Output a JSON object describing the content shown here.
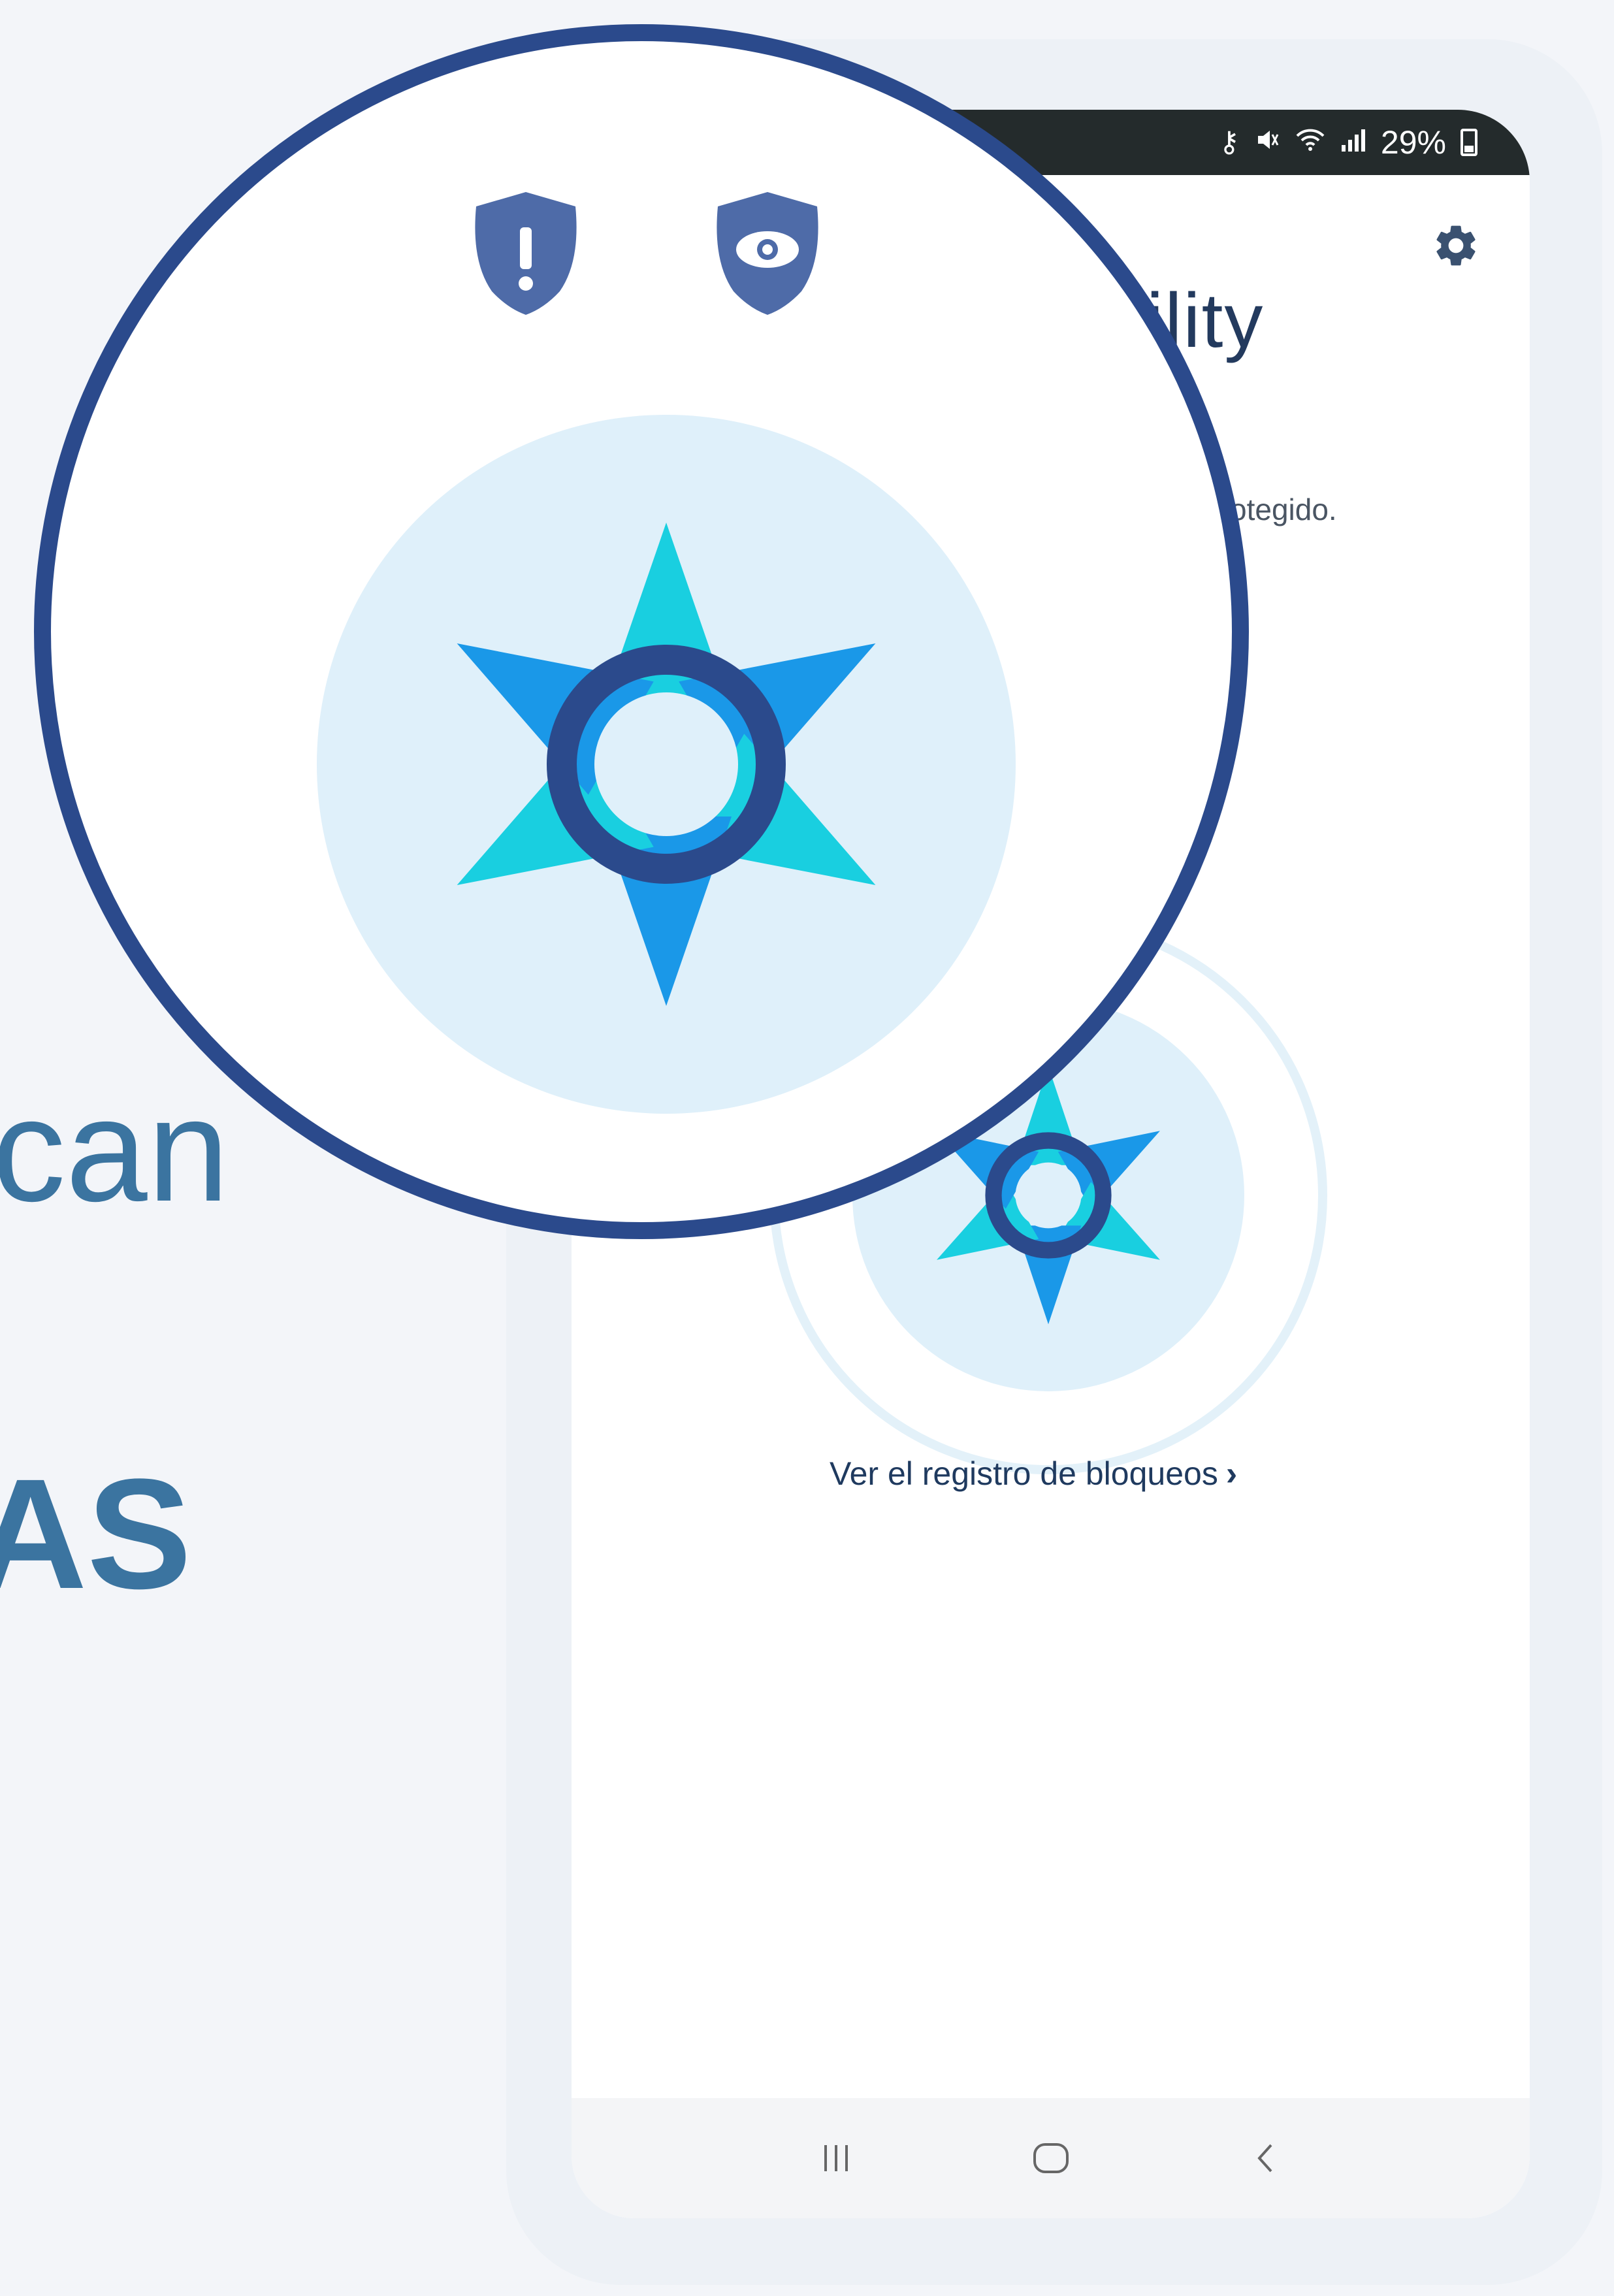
{
  "background_text": {
    "line1": "can",
    "line2": "AS"
  },
  "status_bar": {
    "battery_percent": "29%",
    "icons": [
      "vpn-key-icon",
      "mute-icon",
      "wifi-icon",
      "signal-icon",
      "battery-icon"
    ]
  },
  "app": {
    "title_partial": "ility",
    "status_partial": "otegido."
  },
  "log_link": {
    "label": "Ver el registro de bloqueos",
    "chevron": "›"
  },
  "nav": {
    "items": [
      "recent-apps",
      "home",
      "back"
    ]
  },
  "magnifier": {
    "badges": [
      "shield-alert-icon",
      "shield-eye-icon"
    ]
  },
  "colors": {
    "page_bg": "#f3f5f9",
    "frame_bg": "#edf1f6",
    "brand_dark_blue": "#2b4a8c",
    "brand_cyan": "#19cfe0",
    "brand_blue": "#1a98e8",
    "shield": "#4e6ba8",
    "logo_bg": "#dff0fa",
    "text_blue": "#3b74a0"
  }
}
